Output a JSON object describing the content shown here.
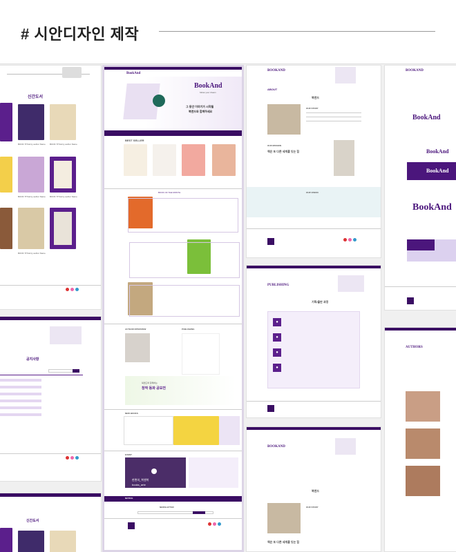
{
  "header": {
    "title": "# 시안디자인 제작"
  },
  "left_card": {
    "section_title": "신간도서",
    "book_caption": "BOOK TITLE by author Name",
    "footer_logo": "B"
  },
  "center_card": {
    "brand": "BookAnd",
    "tagline": "follow your dream",
    "hero_text_1": "그 동안 이야기가 시작될",
    "hero_text_2": "북앤드와 함께하세요",
    "best_seller": "BEST SELLER",
    "book_of_month": "BOOK OF THE MONTH",
    "author_interview": "AUTHOR INTERVIEW",
    "publishing": "PUBLISHING",
    "new_books": "NEW BOOKS",
    "event": "EVENT",
    "contest_1": "북앤드와 함께하는",
    "contest_2": "창작 동화 공모전",
    "notice": "NOTICE",
    "newsletter": "NEWSLETTER",
    "video_caption": "한편의_북앤북",
    "video_caption2": "books_arte"
  },
  "right_card": {
    "brand": "BOOKAND",
    "about": "북앤드",
    "our_story": "OUR STORY",
    "book_title": "책은 또 다른 세계를 잇는 힘",
    "our_vision": "OUR VISION",
    "publishing": "PUBLISHING",
    "pub_title": "기획/출판 과정",
    "authors": "AUTHORS"
  },
  "farright_card": {
    "brand": "BOOKAND",
    "logo_text": "BookAnd",
    "authors": "AUTHORS"
  }
}
